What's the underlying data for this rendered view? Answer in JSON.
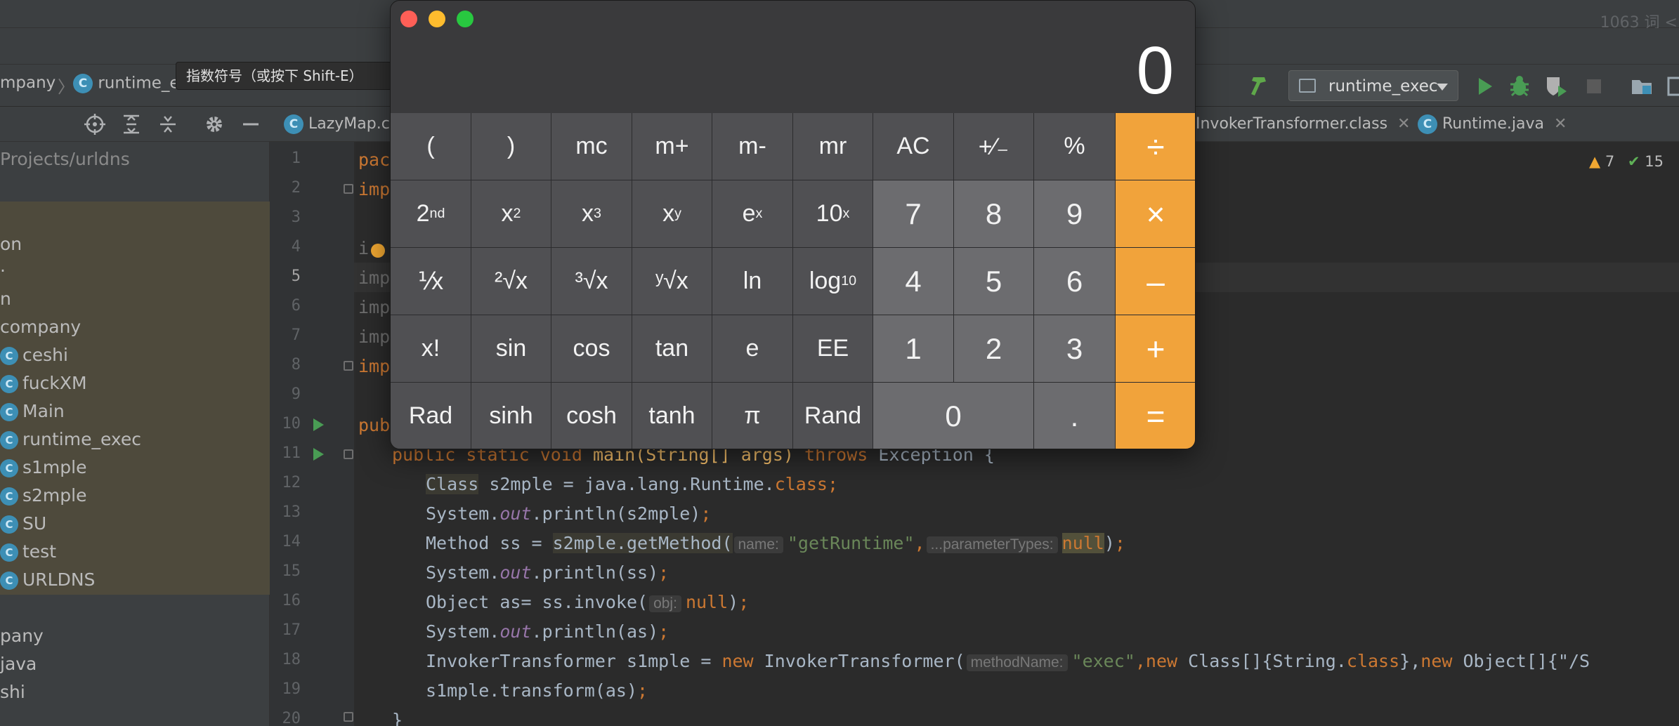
{
  "ide": {
    "word_count": "1063 词 <",
    "tooltip": "指数符号（或按下 Shift-E）",
    "breadcrumb": [
      "mpany",
      "runtime_exec"
    ],
    "run_config": "runtime_exec",
    "tabs": [
      {
        "label": "LazyMap.cl"
      },
      {
        "label": "InvokerTransformer.class"
      },
      {
        "label": "Runtime.java"
      }
    ],
    "project_path": "Projects/urldns",
    "tree": [
      "on",
      "·",
      "n",
      "company",
      "ceshi",
      "fuckXM",
      "Main",
      "runtime_exec",
      "s1mple",
      "s2mple",
      "SU",
      "test",
      "URLDNS",
      "pany",
      "java",
      "shi"
    ],
    "warnings": "7",
    "weak_warnings": "15",
    "line_numbers": [
      "1",
      "2",
      "3",
      "4",
      "5",
      "6",
      "7",
      "8",
      "9",
      "10",
      "11",
      "12",
      "13",
      "14",
      "15",
      "16",
      "17",
      "18",
      "19",
      "20"
    ],
    "code": {
      "l1": "pac",
      "l2": "imp",
      "l4": "i",
      "l5": "imp",
      "l6": "imp",
      "l7": "imp",
      "l8": "imp",
      "l10": "pub",
      "l11_a": "public static void",
      "l11_b": " main(String[] args) ",
      "l11_c": "throws",
      "l11_d": " Exception {",
      "l12_a": "Class",
      "l12_b": " s2mple = java.lang.Runtime.",
      "l12_c": "class",
      "l12_d": ";",
      "l13_a": "System.",
      "l13_b": "out",
      "l13_c": ".println(s2mple)",
      "l13_d": ";",
      "l14_a": "Method ss = ",
      "l14_b": "s2mple.getMethod(",
      "l14_hint1": "name:",
      "l14_c": "\"getRuntime\"",
      "l14_d": ",",
      "l14_hint2": "...parameterTypes:",
      "l14_e": "null",
      "l14_f": ")",
      "l14_g": ";",
      "l15_a": "System.",
      "l15_b": "out",
      "l15_c": ".println(ss)",
      "l15_d": ";",
      "l16_a": "Object as= ss.invoke(",
      "l16_hint": "obj:",
      "l16_b": "null",
      "l16_c": ")",
      "l16_d": ";",
      "l17_a": "System.",
      "l17_b": "out",
      "l17_c": ".println(as)",
      "l17_d": ";",
      "l18_a": "InvokerTransformer s1mple = ",
      "l18_b": "new",
      "l18_c": " InvokerTransformer(",
      "l18_hint": "methodName:",
      "l18_d": "\"exec\"",
      "l18_e": ",",
      "l18_f": "new",
      "l18_g": " Class[]{String.",
      "l18_h": "class",
      "l18_i": "},",
      "l18_j": "new",
      "l18_k": " Object[]{\"/S",
      "l19_a": "s1mple.transform(as)",
      "l19_b": ";",
      "l20": "}"
    }
  },
  "calculator": {
    "display": "0",
    "keys": {
      "r1": [
        "(",
        ")",
        "mc",
        "m+",
        "m-",
        "mr",
        "AC",
        "+∕₋",
        "%",
        "÷"
      ],
      "r2": [
        "7",
        "8",
        "9",
        "×"
      ],
      "r3": [
        "⅟x",
        "²√x",
        "³√x",
        "ʸ√x",
        "ln",
        "4",
        "5",
        "6",
        "–"
      ],
      "r4": [
        "x!",
        "sin",
        "cos",
        "tan",
        "e",
        "EE",
        "1",
        "2",
        "3",
        "+"
      ],
      "r5": [
        "Rad",
        "sinh",
        "cosh",
        "tanh",
        "π",
        "Rand",
        "0",
        ".",
        "="
      ]
    },
    "colors": {
      "operator": "#f1a33b",
      "number": "#6c6c6f",
      "function": "#505053",
      "close": "#fe5f57",
      "minimize": "#febc2e",
      "zoom": "#28c840"
    }
  }
}
